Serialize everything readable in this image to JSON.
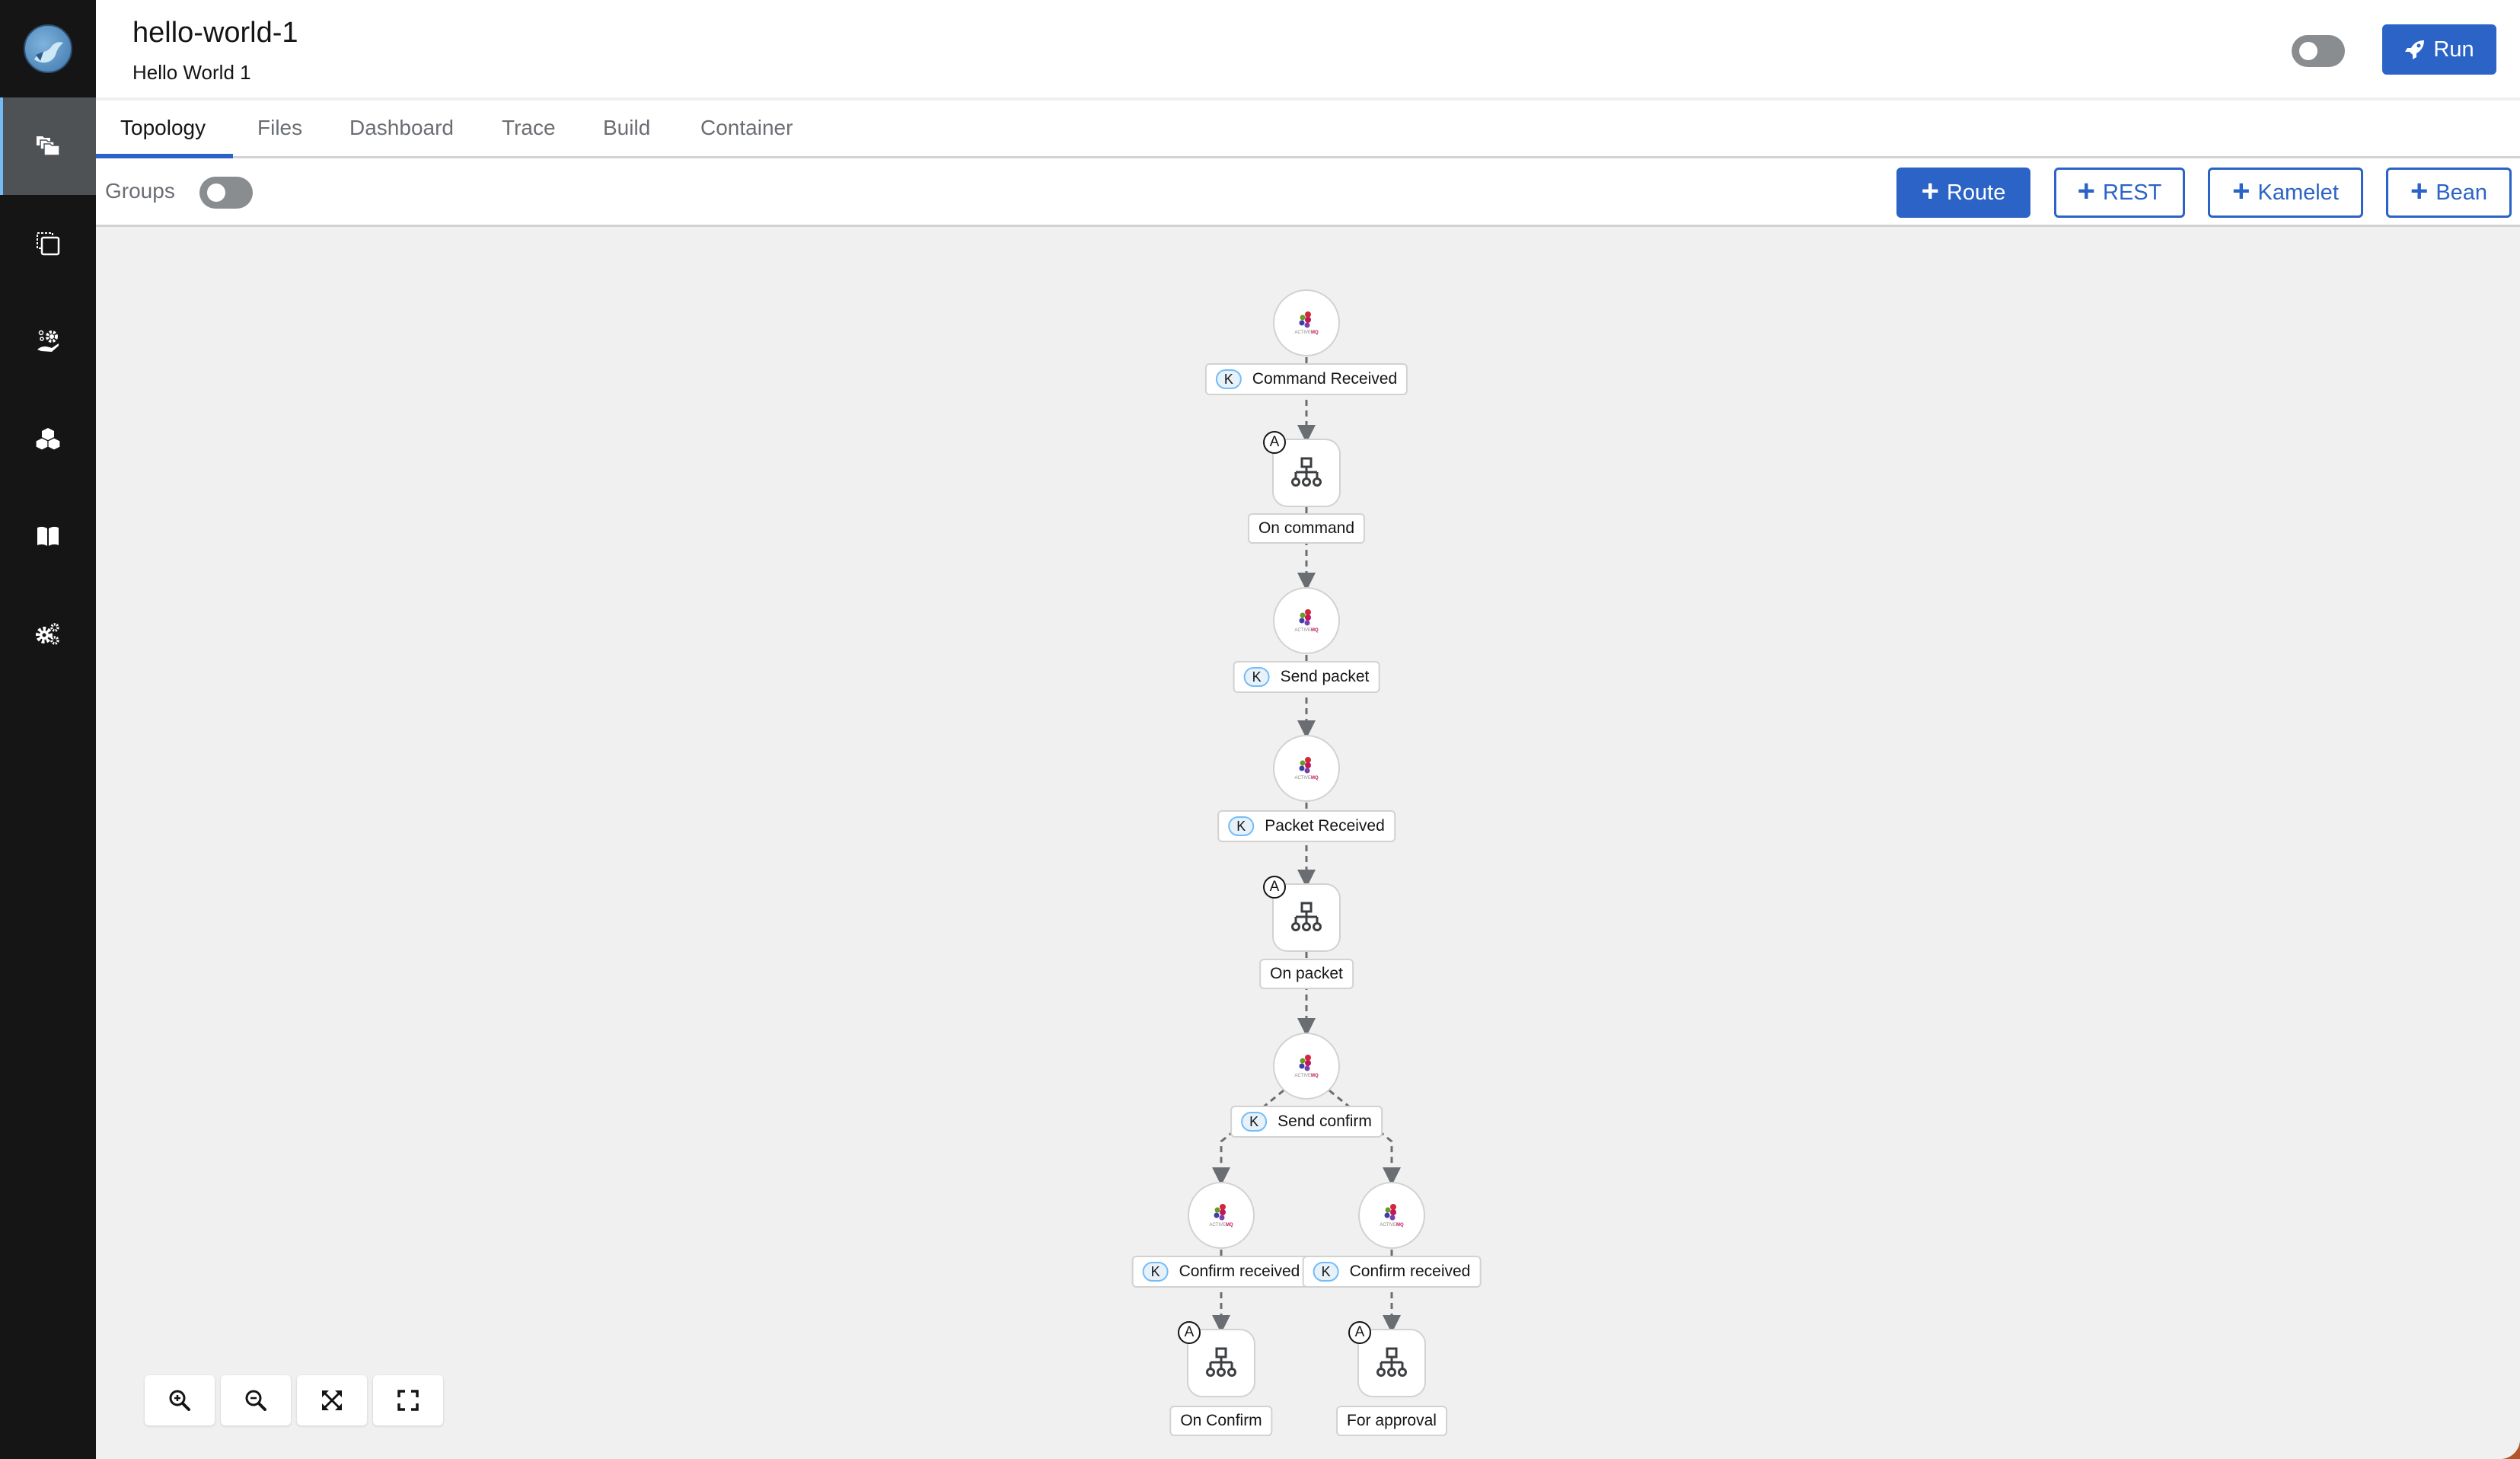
{
  "app": {
    "title": "hello-world-1",
    "subtitle": "Hello World 1",
    "run_label": "Run",
    "run_toggle_on": false
  },
  "sidebar": {
    "items": [
      {
        "name": "projects",
        "icon": "folders-icon",
        "active": true
      },
      {
        "name": "templates",
        "icon": "clone-icon",
        "active": false
      },
      {
        "name": "services",
        "icon": "service-hand-gear-icon",
        "active": false
      },
      {
        "name": "containers",
        "icon": "cubes-icon",
        "active": false
      },
      {
        "name": "knowledgebase",
        "icon": "book-icon",
        "active": false
      },
      {
        "name": "settings",
        "icon": "cogs-icon",
        "active": false
      }
    ]
  },
  "tabs": [
    {
      "label": "Topology",
      "active": true
    },
    {
      "label": "Files",
      "active": false
    },
    {
      "label": "Dashboard",
      "active": false
    },
    {
      "label": "Trace",
      "active": false
    },
    {
      "label": "Build",
      "active": false
    },
    {
      "label": "Container",
      "active": false
    }
  ],
  "toolbar": {
    "groups_label": "Groups",
    "groups_on": false,
    "buttons": [
      {
        "label": "Route",
        "primary": true
      },
      {
        "label": "REST",
        "primary": false
      },
      {
        "label": "Kamelet",
        "primary": false
      },
      {
        "label": "Bean",
        "primary": false
      }
    ]
  },
  "topology": {
    "nodes": [
      {
        "id": "n1",
        "type": "kamelet",
        "icon": "activemq-logo",
        "label": "Command Received",
        "badge": "K"
      },
      {
        "id": "n2",
        "type": "route",
        "icon": "route-icon",
        "label": "On command",
        "badge": "A"
      },
      {
        "id": "n3",
        "type": "kamelet",
        "icon": "activemq-logo",
        "label": "Send packet",
        "badge": "K"
      },
      {
        "id": "n4",
        "type": "kamelet",
        "icon": "activemq-logo",
        "label": "Packet Received",
        "badge": "K"
      },
      {
        "id": "n5",
        "type": "route",
        "icon": "route-icon",
        "label": "On packet",
        "badge": "A"
      },
      {
        "id": "n6",
        "type": "kamelet",
        "icon": "activemq-logo",
        "label": "Send confirm",
        "badge": "K"
      },
      {
        "id": "n7",
        "type": "kamelet",
        "icon": "activemq-logo",
        "label": "Confirm received",
        "badge": "K"
      },
      {
        "id": "n8",
        "type": "kamelet",
        "icon": "activemq-logo",
        "label": "Confirm received",
        "badge": "K"
      },
      {
        "id": "n9",
        "type": "route",
        "icon": "route-icon",
        "label": "On Confirm",
        "badge": "A"
      },
      {
        "id": "n10",
        "type": "route",
        "icon": "route-icon",
        "label": "For approval",
        "badge": "A"
      }
    ],
    "edges": [
      [
        "n1",
        "n2"
      ],
      [
        "n2",
        "n3"
      ],
      [
        "n3",
        "n4"
      ],
      [
        "n4",
        "n5"
      ],
      [
        "n5",
        "n6"
      ],
      [
        "n6",
        "n7"
      ],
      [
        "n6",
        "n8"
      ],
      [
        "n7",
        "n9"
      ],
      [
        "n8",
        "n10"
      ]
    ]
  },
  "zoom_controls": [
    {
      "name": "zoom-in",
      "icon": "zoom-in-icon"
    },
    {
      "name": "zoom-out",
      "icon": "zoom-out-icon"
    },
    {
      "name": "fit-to-screen",
      "icon": "expand-arrows-icon"
    },
    {
      "name": "reset-view",
      "icon": "fullscreen-icon"
    }
  ]
}
